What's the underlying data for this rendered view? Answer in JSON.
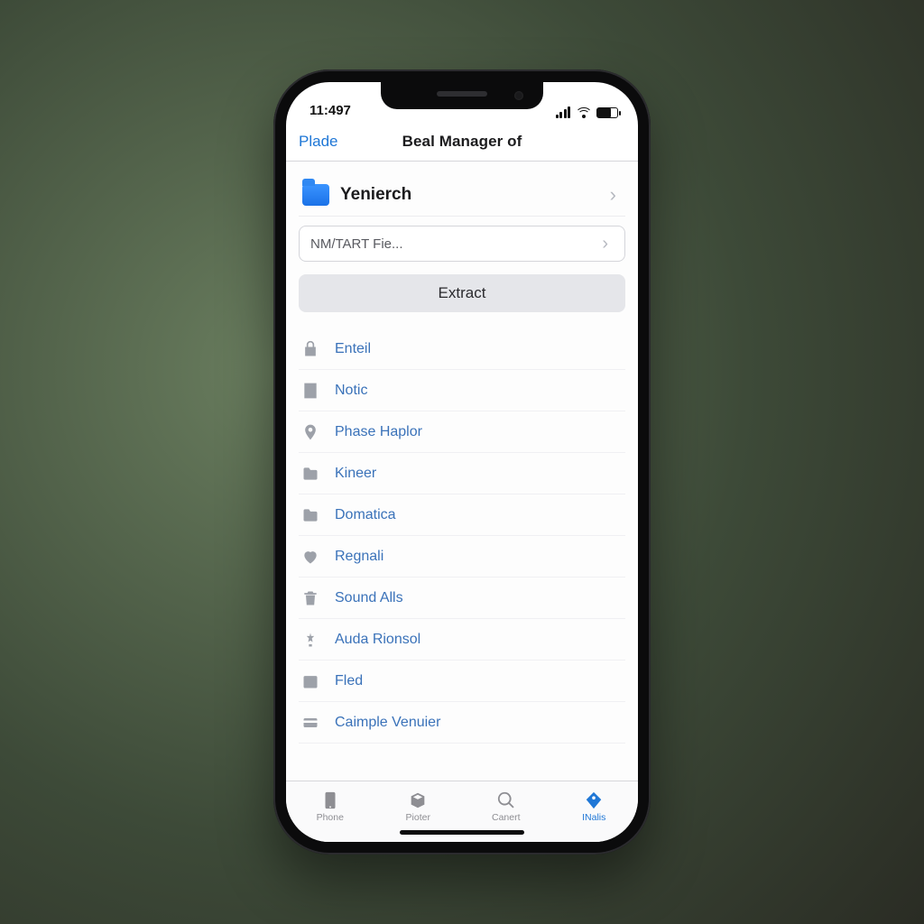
{
  "status": {
    "time": "11:497"
  },
  "nav": {
    "back_label": "Plade",
    "title": "Beal Manager of"
  },
  "folder": {
    "name": "Yenierch"
  },
  "path_field": {
    "placeholder": "NM/TART Fie..."
  },
  "extract": {
    "label": "Extract"
  },
  "items": [
    {
      "icon": "lock-icon",
      "label": "Enteil"
    },
    {
      "icon": "notebook-icon",
      "label": "Notic"
    },
    {
      "icon": "pin-icon",
      "label": "Phase Haplor"
    },
    {
      "icon": "folder-icon",
      "label": "Kineer"
    },
    {
      "icon": "folder-icon",
      "label": "Domatica"
    },
    {
      "icon": "heart-icon",
      "label": "Regnali"
    },
    {
      "icon": "trash-icon",
      "label": "Sound Alls"
    },
    {
      "icon": "audio-icon",
      "label": "Auda Rionsol"
    },
    {
      "icon": "calendar-icon",
      "label": "Fled"
    },
    {
      "icon": "card-icon",
      "label": "Caimple Venuier"
    }
  ],
  "tabs": [
    {
      "icon": "phone-tab-icon",
      "label": "Phone",
      "active": false
    },
    {
      "icon": "box-tab-icon",
      "label": "Pioter",
      "active": false
    },
    {
      "icon": "search-tab-icon",
      "label": "Canert",
      "active": false
    },
    {
      "icon": "tag-tab-icon",
      "label": "INalis",
      "active": true
    }
  ]
}
